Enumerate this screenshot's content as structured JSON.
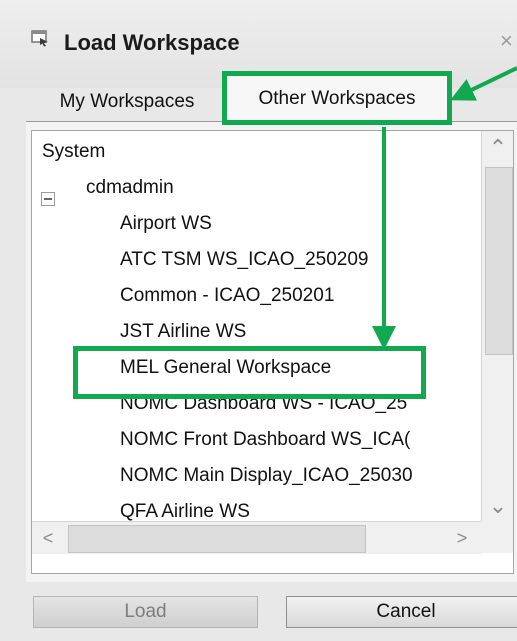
{
  "dialog": {
    "title": "Load Workspace",
    "icon": "workspace-icon",
    "close_glyph": "×"
  },
  "tabs": [
    {
      "label": "My Workspaces",
      "selected": false
    },
    {
      "label": "Other Workspaces",
      "selected": true
    }
  ],
  "tree": {
    "root": "System",
    "group": "cdmadmin",
    "items": [
      "Airport WS",
      "ATC TSM WS_ICAO_250209",
      "Common - ICAO_250201",
      "JST Airline WS",
      "MEL General Workspace",
      "NOMC Dashboard WS - ICAO_25",
      "NOMC Front Dashboard WS_ICA(",
      "NOMC Main Display_ICAO_25030",
      "QFA Airline WS"
    ]
  },
  "scrollbars": {
    "up_glyph": "⌃",
    "down_glyph": "⌄",
    "left_glyph": "<",
    "right_glyph": ">"
  },
  "buttons": {
    "load": "Load",
    "cancel": "Cancel"
  },
  "annotation": {
    "color": "#10a94f"
  }
}
